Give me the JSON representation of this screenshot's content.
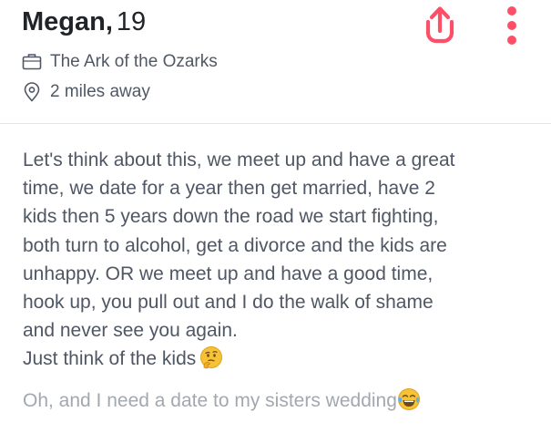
{
  "profile": {
    "name": "Megan,",
    "age": "19",
    "work": "The Ark of the Ozarks",
    "distance": "2 miles away"
  },
  "bio": {
    "lines": [
      "Let's think about this, we meet up and have a great",
      "time, we date for a year then get married, have 2",
      "kids then 5 years down the road we start fighting,",
      "both turn to alcohol, get a divorce and the kids are",
      "unhappy. OR we meet up and have a good time,",
      "hook up, you pull out and I do the walk of shame",
      "and never see you again.",
      "Just think of the kids"
    ],
    "emoji": "thinking-face-icon"
  },
  "prompt": {
    "text": "Oh, and I need a date to my sisters wedding",
    "emoji": "tears-of-joy-icon"
  },
  "icons": {
    "share": "share-icon",
    "more": "more-vertical-icon",
    "work": "briefcase-icon",
    "distance": "location-pin-icon"
  },
  "colors": {
    "accent": "#fd5068",
    "name": "#202428",
    "text": "#505865",
    "muted": "#a2a8b0",
    "emoji": "#f7c236"
  }
}
